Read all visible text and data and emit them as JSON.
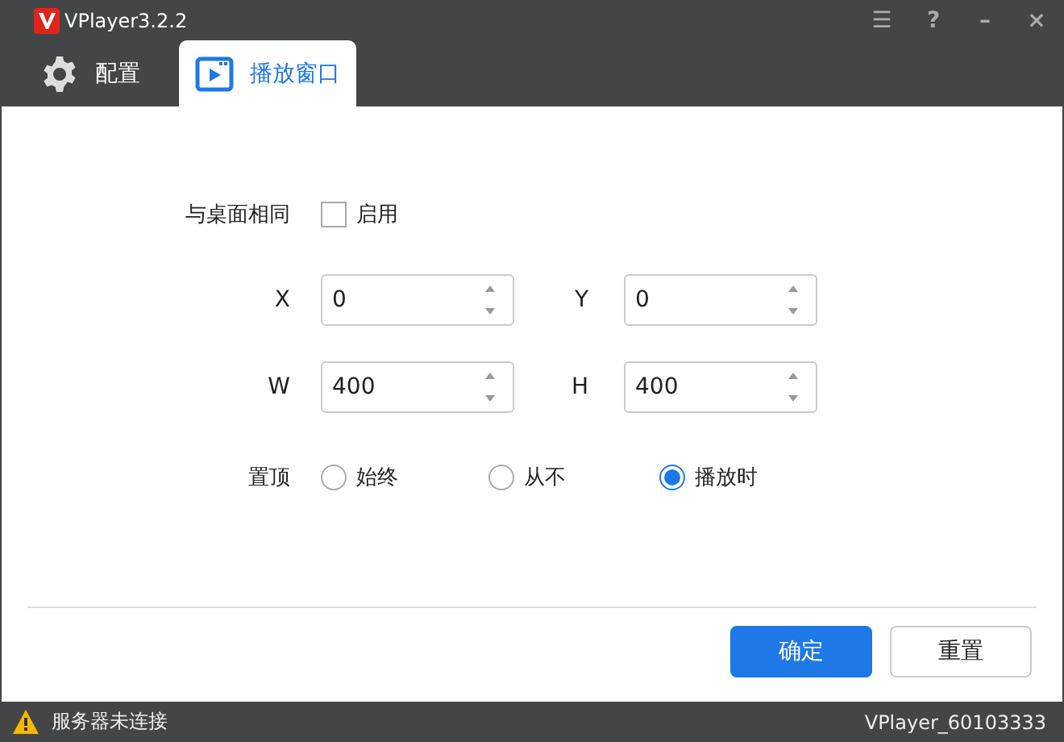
{
  "window": {
    "title": "VPlayer3.2.2",
    "controls": [
      "☰",
      "?",
      "–",
      "×"
    ]
  },
  "tabs": [
    {
      "label": "配置",
      "kind": "gear",
      "selected": false
    },
    {
      "label": "播放窗口",
      "kind": "play",
      "selected": true
    }
  ],
  "same_as_desktop": {
    "label": "与桌面相同",
    "option": "启用",
    "checked": false
  },
  "fields": [
    {
      "label": "X",
      "value": "0"
    },
    {
      "label": "Y",
      "value": "0"
    },
    {
      "label": "W",
      "value": "400"
    },
    {
      "label": "H",
      "value": "400"
    }
  ],
  "topmost": {
    "label": "置顶",
    "options": [
      {
        "label": "始终",
        "selected": false
      },
      {
        "label": "从不",
        "selected": false
      },
      {
        "label": "播放时",
        "selected": true
      }
    ]
  },
  "buttons": [
    {
      "label": "确定",
      "kind": "primary"
    },
    {
      "label": "重置",
      "kind": "default"
    }
  ],
  "status_bar": {
    "message": "服务器未连接",
    "device": "VPlayer_60103333"
  }
}
